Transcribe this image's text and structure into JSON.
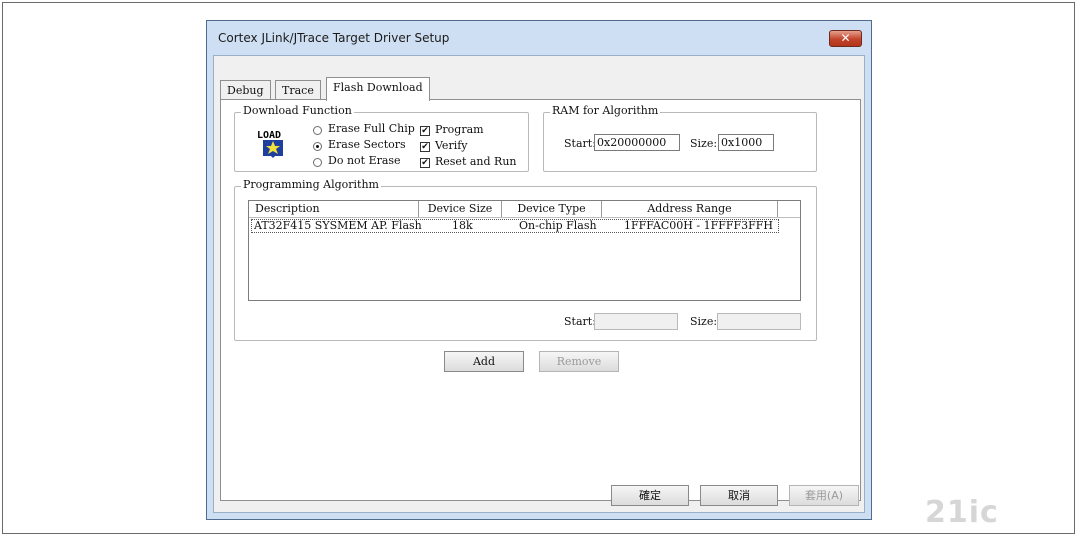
{
  "window": {
    "title": "Cortex JLink/JTrace Target Driver Setup",
    "close_glyph": "✕"
  },
  "tabs": [
    {
      "label": "Debug",
      "active": false
    },
    {
      "label": "Trace",
      "active": false
    },
    {
      "label": "Flash Download",
      "active": true
    }
  ],
  "download_function": {
    "group_label": "Download Function",
    "icon_text": "LOAD",
    "erase_options": [
      {
        "label": "Erase Full Chip",
        "selected": false
      },
      {
        "label": "Erase Sectors",
        "selected": true
      },
      {
        "label": "Do not Erase",
        "selected": false
      }
    ],
    "checks": [
      {
        "label": "Program",
        "checked": true
      },
      {
        "label": "Verify",
        "checked": true
      },
      {
        "label": "Reset and Run",
        "checked": true
      }
    ],
    "check_mark": "✔"
  },
  "ram_for_algorithm": {
    "group_label": "RAM for Algorithm",
    "start_label": "Start:",
    "start_value": "0x20000000",
    "size_label": "Size:",
    "size_value": "0x1000"
  },
  "programming_algorithm": {
    "group_label": "Programming Algorithm",
    "columns": [
      "Description",
      "Device Size",
      "Device Type",
      "Address Range"
    ],
    "rows": [
      {
        "description": "AT32F415 SYSMEM AP. Flash",
        "device_size": "18k",
        "device_type": "On-chip Flash",
        "address_range": "1FFFAC00H - 1FFFF3FFH"
      }
    ],
    "start_label": "Start:",
    "start_value": "",
    "size_label": "Size:",
    "size_value": ""
  },
  "actions": {
    "add_label": "Add",
    "remove_label": "Remove"
  },
  "footer": {
    "ok_label": "確定",
    "cancel_label": "取消",
    "apply_label": "套用(A)"
  },
  "watermark": {
    "text": "21ic"
  }
}
